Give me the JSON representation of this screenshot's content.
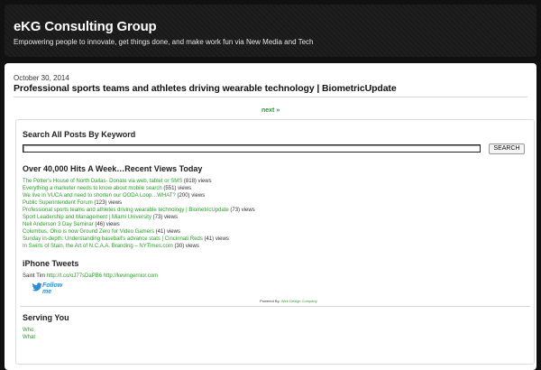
{
  "site": {
    "title": "eKG Consulting Group",
    "tagline": "Empowering people to innovate, get things done, and make work fun via New Media and Tech"
  },
  "post": {
    "date": "October 30, 2014",
    "title": "Professional sports teams and athletes driving wearable technology | BiometricUpdate",
    "next_label": "next »"
  },
  "search": {
    "title": "Search All Posts By Keyword",
    "value": "",
    "button_label": "SEARCH"
  },
  "recent": {
    "title": "Over 40,000 Hits A Week…Recent Views Today",
    "items": [
      {
        "title": "The Potter's House of North Dallas- Donate via web, tablet or SMS",
        "views": "(818) views"
      },
      {
        "title": "Everything a marketer needs to know about mobile search",
        "views": "(551) views"
      },
      {
        "title": "We live in VUCA and need to shorten our OODA Loop…WHAT?",
        "views": "(200) views"
      },
      {
        "title": "Public Superintendent Forum",
        "views": "(123) views"
      },
      {
        "title": "Professional sports teams and athletes driving wearable technology | BiometricUpdate",
        "views": "(73) views"
      },
      {
        "title": "Sport Leadership and Management | Miami University",
        "views": "(73) views"
      },
      {
        "title": "Neil Anderson 3 Day Seminar",
        "views": "(46) views"
      },
      {
        "title": "Columbus, Ohio is now Ground Zero for Video Gamers",
        "views": "(41) views"
      },
      {
        "title": "Sunday in-depth: Understanding baseball's advance stats | Cincinnati Reds",
        "views": "(41) views"
      },
      {
        "title": "In Swirls of Stain, the Art of N.C.A.A. Branding – NYTimes.com",
        "views": "(30) views"
      }
    ]
  },
  "tweets": {
    "title": "iPhone Tweets",
    "author": "Saint Tim",
    "link1": "http://t.co/oJ77sDaPB6",
    "link2": "http://kevingernior.com",
    "follow_label": "Follow me"
  },
  "powered": {
    "label": "Powered By:",
    "link": "Web Design Company"
  },
  "serving": {
    "title": "Serving You",
    "items": [
      "Who",
      "What"
    ]
  },
  "colors": {
    "link": "#2a9d2a",
    "header_bg": "#1c1c1c",
    "twitter": "#2b8fd8"
  }
}
